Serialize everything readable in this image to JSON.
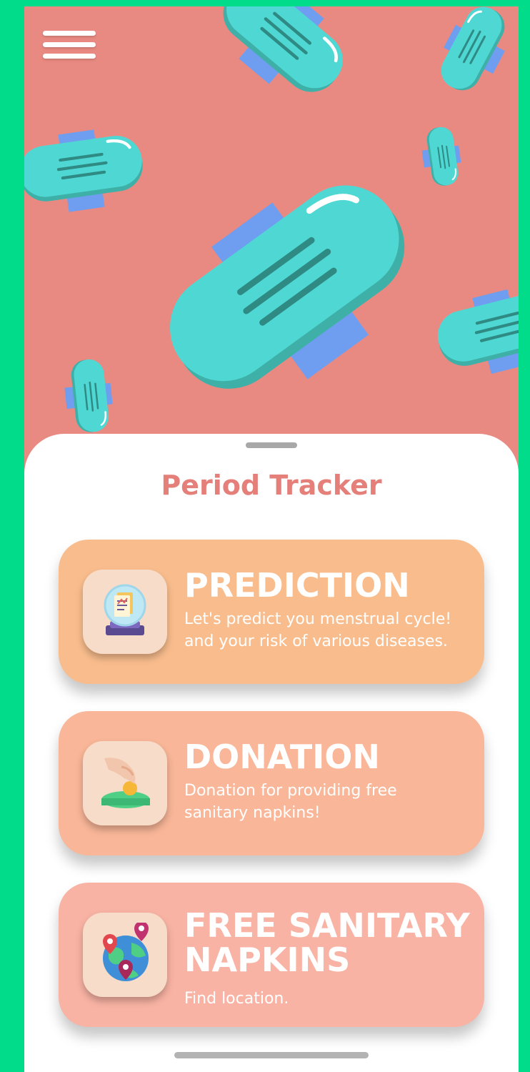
{
  "app": {
    "title": "Period Tracker"
  },
  "colors": {
    "background": "#00dc8a",
    "hero": "#e88a82",
    "accent": "#e57f79",
    "pad": "#4fd8d3"
  },
  "menu": {
    "icon": "hamburger-icon"
  },
  "cards": [
    {
      "title": "PREDICTION",
      "description_line1": "Let's predict you menstrual cycle!",
      "description_line2": "and your risk of various diseases.",
      "icon": "crystal-ball-report-icon"
    },
    {
      "title": "DONATION",
      "description_line1": "Donation for providing free",
      "description_line2": "sanitary napkins!",
      "icon": "coin-donation-icon"
    },
    {
      "title_line1": "FREE SANITARY",
      "title_line2": "NAPKINS",
      "description": "Find location.",
      "icon": "globe-location-pins-icon"
    }
  ]
}
